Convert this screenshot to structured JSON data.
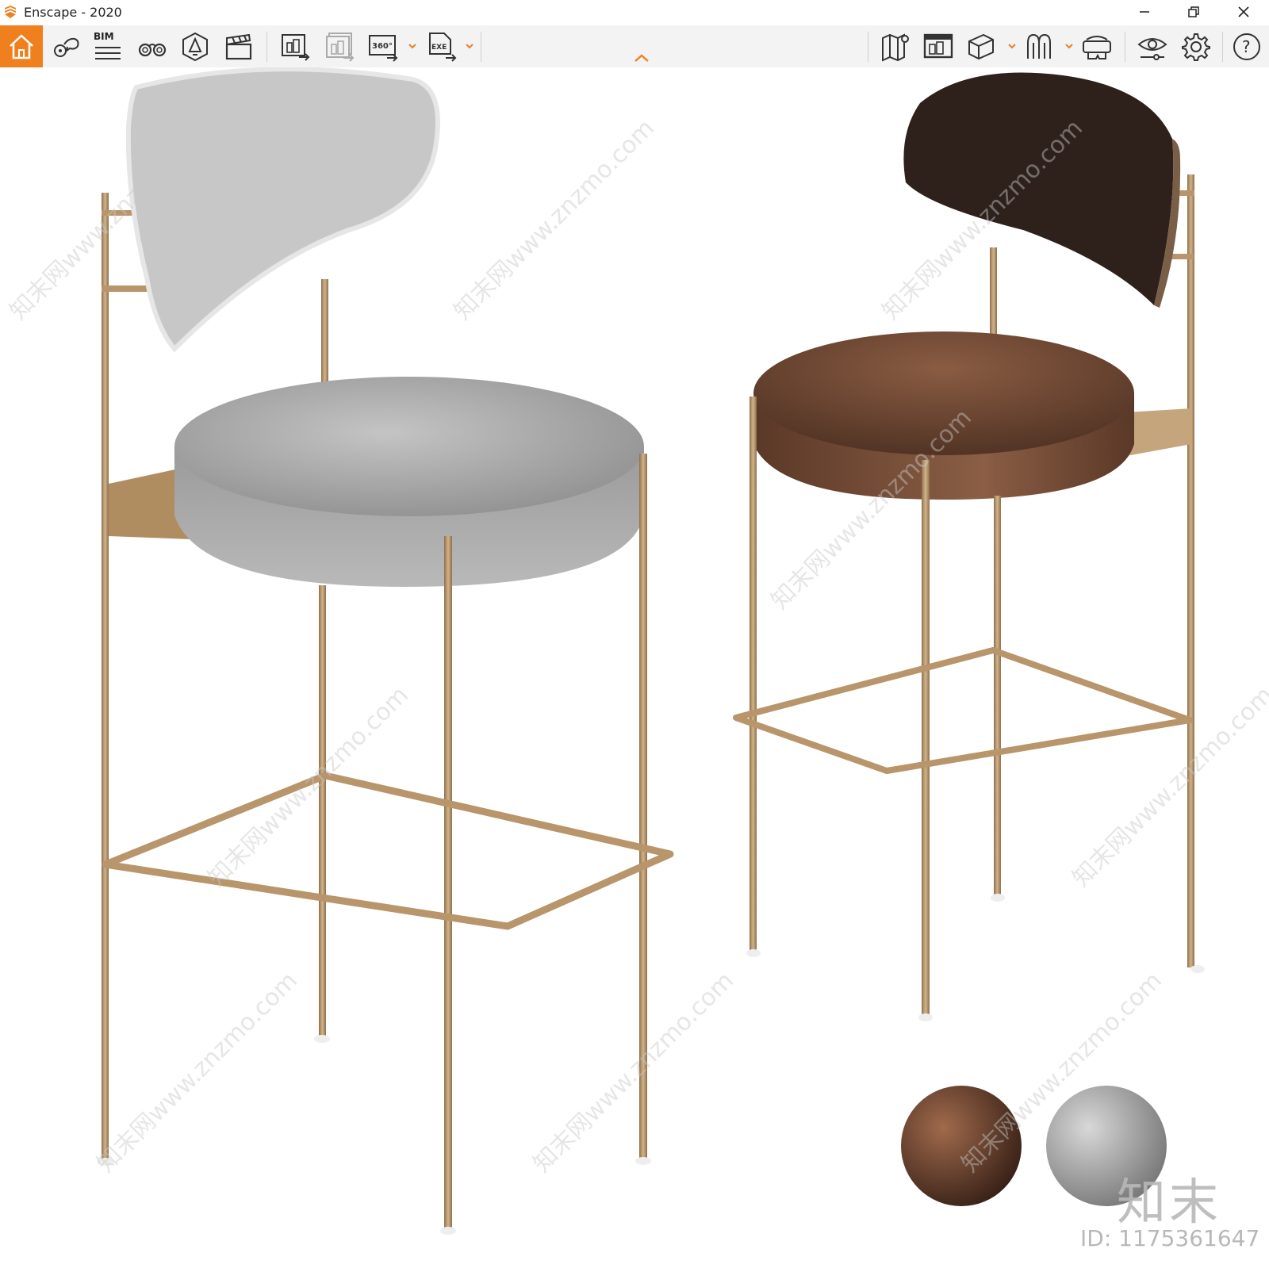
{
  "window": {
    "title": "Enscape - 2020",
    "accent_color": "#f07f1d",
    "controls": [
      "minimize-icon",
      "restore-icon",
      "close-icon"
    ]
  },
  "toolbar": {
    "home_icon": "home-icon",
    "bim_label": "BIM",
    "left_icons": [
      "location-pin-icon",
      "bim-info-icon",
      "binoculars-icon",
      "light-view-icon",
      "clapperboard-icon"
    ],
    "export_icons": [
      "screenshot-export-icon",
      "batch-export-icon",
      "panorama-360-icon",
      "exe-export-icon"
    ],
    "panorama_label": "360°",
    "exe_label": "EXE",
    "right_icons": [
      "map-icon",
      "asset-library-icon",
      "cube-view-icon",
      "people-icon",
      "vr-headset-icon",
      "visual-settings-icon",
      "gear-icon",
      "help-icon"
    ],
    "help_label": "?"
  },
  "viewport": {
    "scene": "bar-stools-render",
    "watermark_logo": "知末",
    "watermark_id": "ID: 1175361647",
    "watermark_url": "知末网www.znzmo.com",
    "colors": {
      "gold_frame": "#b8956a",
      "grey_fabric": "#a9a9a9",
      "brown_leather": "#6b4632",
      "dark_backrest": "#2a1e18"
    }
  }
}
